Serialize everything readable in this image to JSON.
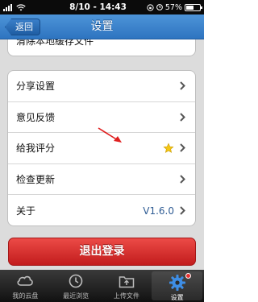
{
  "status_bar": {
    "time": "8/10 - 14:43",
    "battery_percent": "57%",
    "signal_bars": 4,
    "battery_level": 0.57
  },
  "nav": {
    "title": "设置",
    "back_label": "返回"
  },
  "partial_item": {
    "label": "清除本地缓存文件"
  },
  "settings": {
    "items": [
      {
        "label": "分享设置",
        "value": "",
        "icon": "chevron-right-icon"
      },
      {
        "label": "意见反馈",
        "value": "",
        "icon": "chevron-right-icon"
      },
      {
        "label": "给我评分",
        "value": "",
        "icon": "star-icon"
      },
      {
        "label": "检查更新",
        "value": "",
        "icon": "chevron-right-icon"
      },
      {
        "label": "关于",
        "value": "V1.6.0",
        "icon": "chevron-right-icon"
      }
    ]
  },
  "logout": {
    "label": "退出登录"
  },
  "tabs": [
    {
      "label": "我的云盘",
      "icon": "cloud-icon",
      "active": false
    },
    {
      "label": "最近浏览",
      "icon": "clock-icon",
      "active": false
    },
    {
      "label": "上传文件",
      "icon": "upload-folder-icon",
      "active": false
    },
    {
      "label": "设置",
      "icon": "gear-icon",
      "active": true
    }
  ],
  "colors": {
    "nav_blue": "#2e74c0",
    "logout_red": "#d42a27",
    "value_blue": "#2f5c94",
    "annotation_arrow": "#e02020"
  }
}
